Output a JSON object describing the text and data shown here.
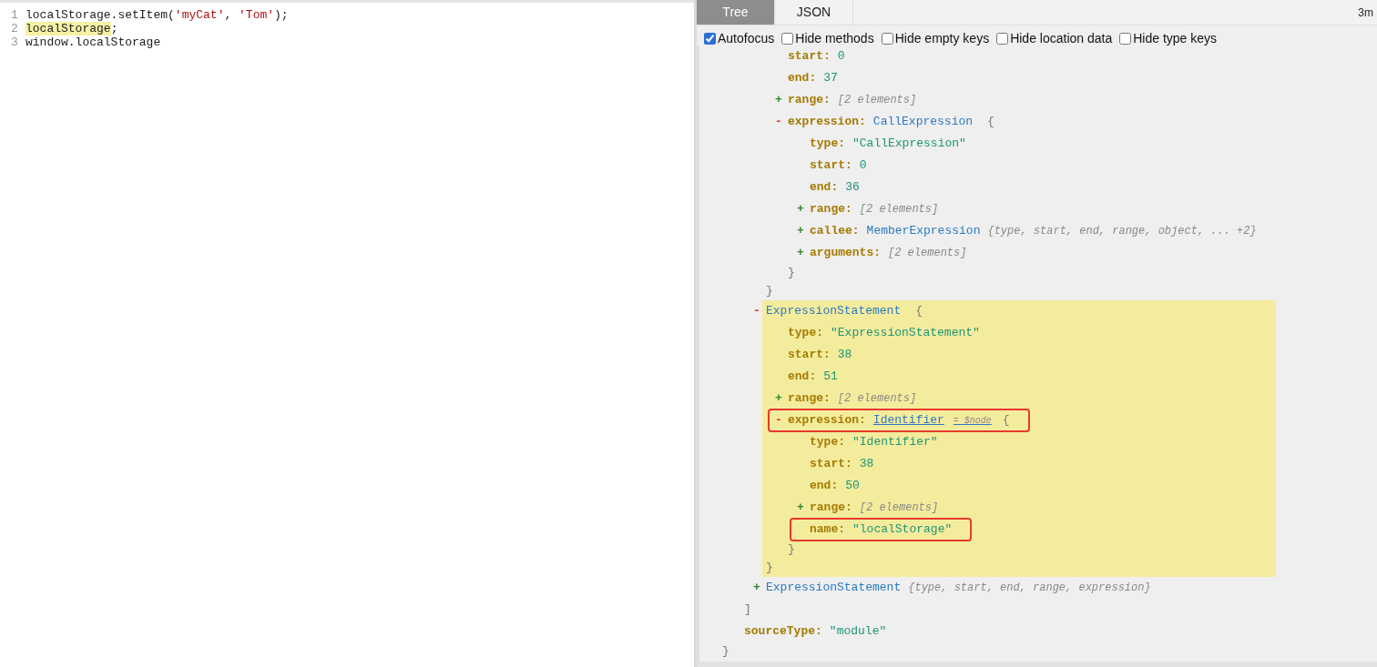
{
  "editor": {
    "lines": [
      {
        "number": "1",
        "tokens": [
          {
            "text": "localStorage.setItem(",
            "kind": "plain",
            "highlighted": false
          },
          {
            "text": "'myCat'",
            "kind": "string",
            "highlighted": false
          },
          {
            "text": ", ",
            "kind": "plain",
            "highlighted": false
          },
          {
            "text": "'Tom'",
            "kind": "string",
            "highlighted": false
          },
          {
            "text": ");",
            "kind": "plain",
            "highlighted": false
          }
        ]
      },
      {
        "number": "2",
        "tokens": [
          {
            "text": "localStorage",
            "kind": "plain",
            "highlighted": true
          },
          {
            "text": ";",
            "kind": "plain",
            "highlighted": false
          }
        ]
      },
      {
        "number": "3",
        "tokens": [
          {
            "text": "window.localStorage",
            "kind": "plain",
            "highlighted": false
          }
        ]
      }
    ]
  },
  "tabs": [
    {
      "label": "Tree",
      "selected": true
    },
    {
      "label": "JSON",
      "selected": false
    }
  ],
  "timing": "3m",
  "options": [
    {
      "label": "Autofocus",
      "checked": true
    },
    {
      "label": "Hide methods",
      "checked": false
    },
    {
      "label": "Hide empty keys",
      "checked": false
    },
    {
      "label": "Hide location data",
      "checked": false
    },
    {
      "label": "Hide type keys",
      "checked": false
    }
  ],
  "tree": {
    "kind": "group",
    "close": "}",
    "highlighted": false,
    "children": [
      {
        "kind": "group",
        "close": "]",
        "highlighted": false,
        "children": [
          {
            "kind": "group",
            "close": "}",
            "highlighted": false,
            "children": [
              {
                "kind": "field",
                "key": "start:",
                "value": "0",
                "outlined": false
              },
              {
                "kind": "field",
                "key": "end:",
                "value": "37",
                "outlined": false
              },
              {
                "kind": "collapsed",
                "toggle": "+",
                "key": "range:",
                "summary": "[2 elements]"
              },
              {
                "kind": "group",
                "close": "}",
                "highlighted": false,
                "header": {
                  "toggle": "-",
                  "key": "expression:",
                  "type_name": "CallExpression",
                  "brace": "{",
                  "outlined": false,
                  "linked": false
                },
                "children": [
                  {
                    "kind": "field",
                    "key": "type:",
                    "value": "\"CallExpression\"",
                    "outlined": false
                  },
                  {
                    "kind": "field",
                    "key": "start:",
                    "value": "0",
                    "outlined": false
                  },
                  {
                    "kind": "field",
                    "key": "end:",
                    "value": "36",
                    "outlined": false
                  },
                  {
                    "kind": "collapsed",
                    "toggle": "+",
                    "key": "range:",
                    "summary": "[2 elements]"
                  },
                  {
                    "kind": "collapsed",
                    "toggle": "+",
                    "key": "callee:",
                    "type_name": "MemberExpression",
                    "summary": "{type, start, end, range, object, ... +2}"
                  },
                  {
                    "kind": "collapsed",
                    "toggle": "+",
                    "key": "arguments:",
                    "summary": "[2 elements]"
                  }
                ]
              }
            ]
          },
          {
            "kind": "group",
            "close": "}",
            "highlighted": true,
            "header": {
              "toggle": "-",
              "type_name": "ExpressionStatement",
              "brace": "{",
              "outlined": false,
              "linked": false
            },
            "children": [
              {
                "kind": "field",
                "key": "type:",
                "value": "\"ExpressionStatement\"",
                "outlined": false
              },
              {
                "kind": "field",
                "key": "start:",
                "value": "38",
                "outlined": false
              },
              {
                "kind": "field",
                "key": "end:",
                "value": "51",
                "outlined": false
              },
              {
                "kind": "collapsed",
                "toggle": "+",
                "key": "range:",
                "summary": "[2 elements]"
              },
              {
                "kind": "group",
                "close": "}",
                "highlighted": false,
                "header": {
                  "toggle": "-",
                  "key": "expression:",
                  "type_name": "Identifier",
                  "ref": "= $node",
                  "brace": "{",
                  "outlined": true,
                  "linked": true
                },
                "children": [
                  {
                    "kind": "field",
                    "key": "type:",
                    "value": "\"Identifier\"",
                    "outlined": false
                  },
                  {
                    "kind": "field",
                    "key": "start:",
                    "value": "38",
                    "outlined": false
                  },
                  {
                    "kind": "field",
                    "key": "end:",
                    "value": "50",
                    "outlined": false
                  },
                  {
                    "kind": "collapsed",
                    "toggle": "+",
                    "key": "range:",
                    "summary": "[2 elements]"
                  },
                  {
                    "kind": "field",
                    "key": "name:",
                    "value": "\"localStorage\"",
                    "outlined": true
                  }
                ]
              }
            ]
          },
          {
            "kind": "collapsed",
            "toggle": "+",
            "type_name": "ExpressionStatement",
            "summary": "{type, start, end, range, expression}"
          }
        ]
      },
      {
        "kind": "field",
        "key": "sourceType:",
        "value": "\"module\"",
        "outlined": false
      }
    ]
  }
}
